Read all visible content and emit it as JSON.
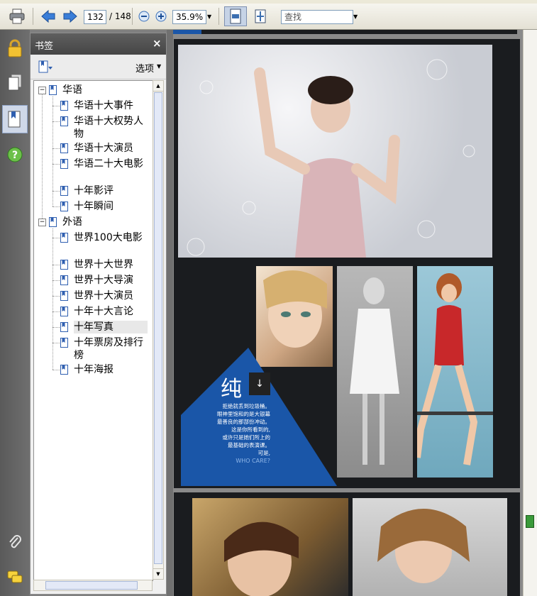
{
  "toolbar": {
    "page_current": "132",
    "page_total": "/ 148",
    "zoom": "35.9%",
    "search_placeholder": "查找"
  },
  "bookmarks_panel": {
    "title": "书签",
    "close_glyph": "×",
    "options_label": "选项",
    "tree": {
      "group_chinese": "华语",
      "chinese_items": [
        "华语十大事件",
        "华语十大权势人物",
        "华语十大演员",
        "华语二十大电影",
        "十年影评",
        "十年瞬间"
      ],
      "group_foreign": "外语",
      "foreign_items": [
        "世界100大电影",
        "世界十大世界",
        "世界十大导演",
        "世界十大演员",
        "十年十大言论",
        "十年写真",
        "十年票房及排行榜",
        "十年海报"
      ]
    }
  },
  "page": {
    "big_char": "纯",
    "arrow": "↓",
    "poem_lines": [
      "拒绝就丢到垃圾桶。",
      "眼神里饱和的是大银幕",
      "最善良的那部份冲动。",
      "这是你所看到的,",
      "或许只是她们所上的",
      "最基础的表演课。",
      "可是,"
    ],
    "poem_en": "WHO CARE?"
  },
  "colors": {
    "accent_blue": "#1a56a8",
    "page_dark": "#1a1c1f"
  },
  "icons": [
    "print-icon",
    "prev-page-icon",
    "next-page-icon",
    "zoom-out-icon",
    "zoom-in-icon",
    "fit-width-icon",
    "fit-page-icon",
    "lock-icon",
    "pages-icon",
    "bookmarks-icon",
    "help-icon",
    "attachment-icon",
    "comments-icon",
    "new-bookmark-icon",
    "bookmark-icon"
  ]
}
